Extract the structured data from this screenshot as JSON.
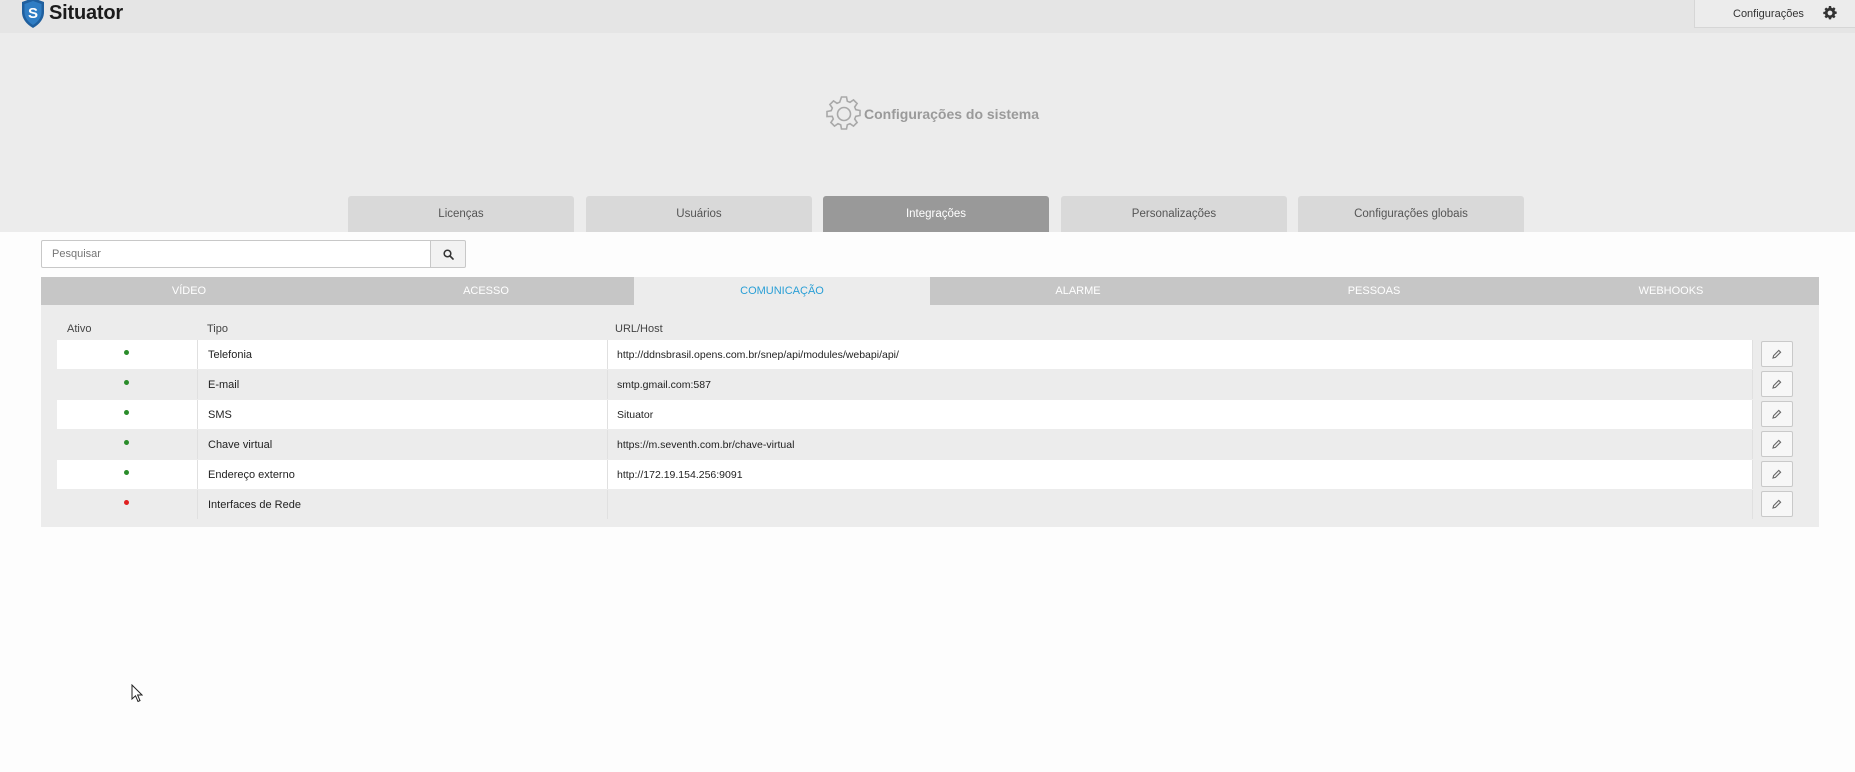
{
  "app": {
    "name": "Situator",
    "settings_label": "Configurações"
  },
  "colors": {
    "accent": "#2a9fd6",
    "active_tab": "#999999",
    "status_on": "#2a8c2a",
    "status_off": "#e02020"
  },
  "page": {
    "title": "Configurações do sistema"
  },
  "main_tabs": [
    {
      "label": "Licenças",
      "active": false
    },
    {
      "label": "Usuários",
      "active": false
    },
    {
      "label": "Integrações",
      "active": true
    },
    {
      "label": "Personalizações",
      "active": false
    },
    {
      "label": "Configurações globais",
      "active": false
    }
  ],
  "search": {
    "placeholder": "Pesquisar",
    "value": ""
  },
  "sub_tabs": [
    {
      "label": "VÍDEO",
      "active": false
    },
    {
      "label": "ACESSO",
      "active": false
    },
    {
      "label": "COMUNICAÇÃO",
      "active": true
    },
    {
      "label": "ALARME",
      "active": false
    },
    {
      "label": "PESSOAS",
      "active": false
    },
    {
      "label": "WEBHOOKS",
      "active": false
    }
  ],
  "table": {
    "headers": {
      "ativo": "Ativo",
      "tipo": "Tipo",
      "url": "URL/Host"
    },
    "rows": [
      {
        "active": true,
        "tipo": "Telefonia",
        "url": "http://ddnsbrasil.opens.com.br/snep/api/modules/webapi/api/"
      },
      {
        "active": true,
        "tipo": "E-mail",
        "url": "smtp.gmail.com:587"
      },
      {
        "active": true,
        "tipo": "SMS",
        "url": "Situator"
      },
      {
        "active": true,
        "tipo": "Chave virtual",
        "url": "https://m.seventh.com.br/chave-virtual"
      },
      {
        "active": true,
        "tipo": "Endereço externo",
        "url": "http://172.19.154.256:9091"
      },
      {
        "active": false,
        "tipo": "Interfaces de Rede",
        "url": ""
      }
    ]
  },
  "icons": {
    "settings": "gear-icon",
    "search": "search-icon",
    "edit": "pencil-icon"
  }
}
